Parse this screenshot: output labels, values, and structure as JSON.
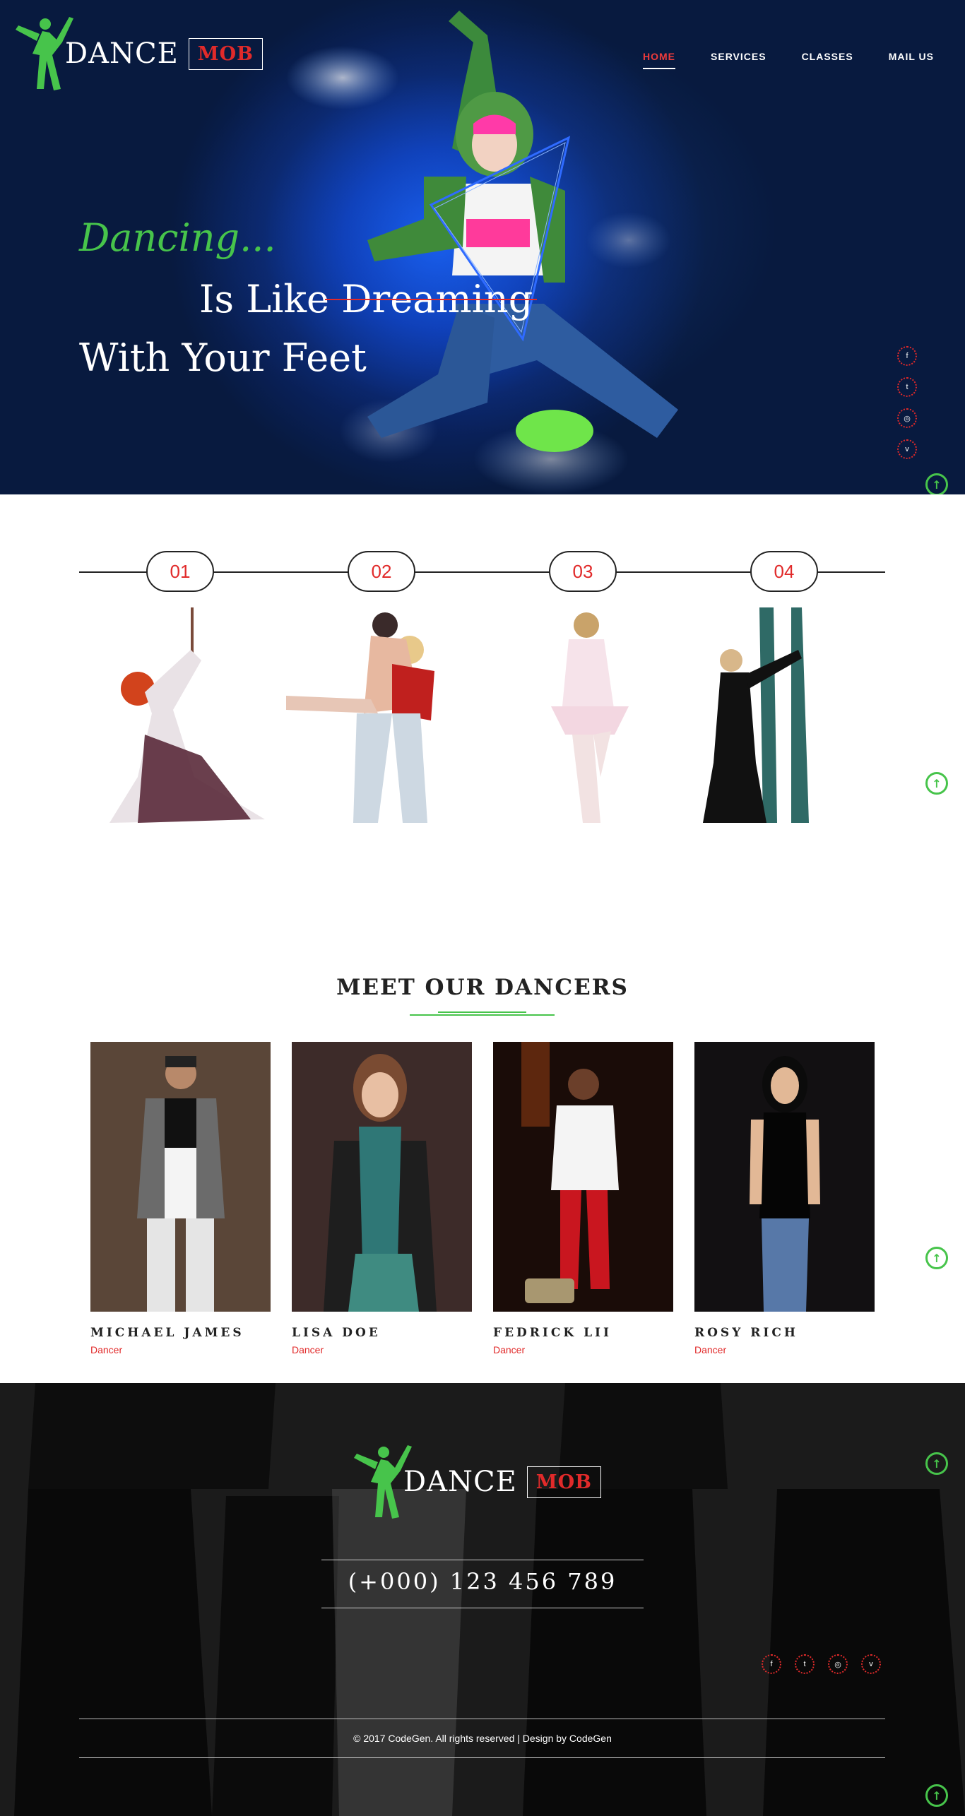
{
  "brand": {
    "word": "DANCE",
    "box": "MOB"
  },
  "nav": [
    {
      "label": "HOME",
      "active": true
    },
    {
      "label": "SERVICES"
    },
    {
      "label": "CLASSES"
    },
    {
      "label": "MAIL US"
    }
  ],
  "hero": {
    "line1": "Dancing...",
    "line2": "Is Like Dreaming",
    "line3": "With Your Feet"
  },
  "social": [
    {
      "icon": "facebook-icon",
      "glyph": "f"
    },
    {
      "icon": "twitter-icon",
      "glyph": "t"
    },
    {
      "icon": "dribbble-icon",
      "glyph": "◎"
    },
    {
      "icon": "vimeo-icon",
      "glyph": "v"
    }
  ],
  "steps": [
    "01",
    "02",
    "03",
    "04"
  ],
  "team": {
    "title": "MEET OUR DANCERS",
    "members": [
      {
        "name": "MICHAEL JAMES",
        "role": "Dancer"
      },
      {
        "name": "LISA DOE",
        "role": "Dancer"
      },
      {
        "name": "FEDRICK LII",
        "role": "Dancer"
      },
      {
        "name": "ROSY RICH",
        "role": "Dancer"
      }
    ]
  },
  "footer": {
    "phone": "(+000) 123 456 789",
    "copyright": "© 2017 CodeGen. All rights reserved | Design by CodeGen"
  },
  "colors": {
    "accent_red": "#e12a2a",
    "accent_green": "#47c44b",
    "hero_blue": "#0c39b0"
  }
}
